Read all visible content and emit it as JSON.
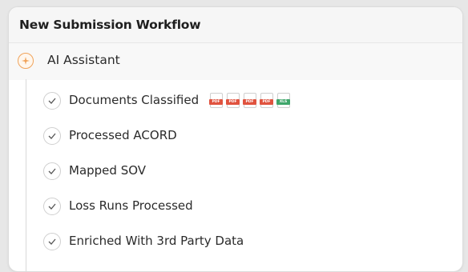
{
  "panel": {
    "title": "New Submission Workflow"
  },
  "assistant": {
    "label": "AI Assistant",
    "icon": "sparkle-icon",
    "accent_color": "#f0a35a"
  },
  "steps": [
    {
      "label": "Documents Classified",
      "icon": "check-icon",
      "files": [
        {
          "type": "PDF",
          "color": "#e0533f"
        },
        {
          "type": "PDF",
          "color": "#e0533f"
        },
        {
          "type": "PDF",
          "color": "#e0533f"
        },
        {
          "type": "PDF",
          "color": "#e0533f"
        },
        {
          "type": "XLS",
          "color": "#3fa66b"
        }
      ]
    },
    {
      "label": "Processed ACORD",
      "icon": "check-icon"
    },
    {
      "label": "Mapped SOV",
      "icon": "check-icon"
    },
    {
      "label": "Loss Runs Processed",
      "icon": "check-icon"
    },
    {
      "label": "Enriched With 3rd Party Data",
      "icon": "check-icon"
    }
  ]
}
